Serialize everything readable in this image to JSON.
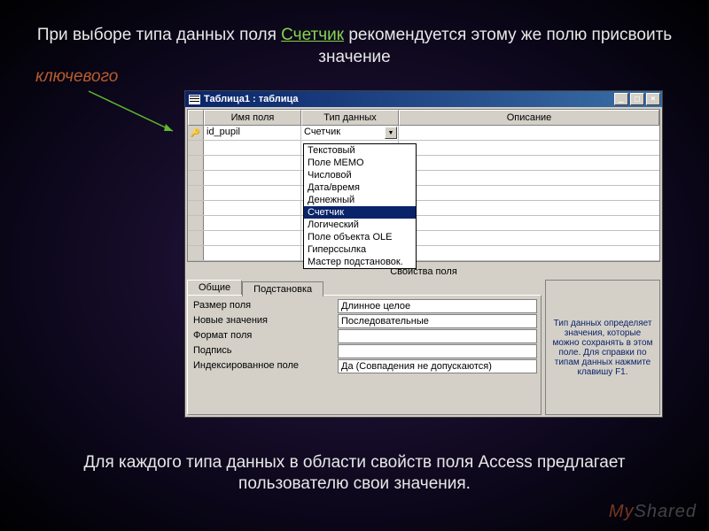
{
  "slide": {
    "top_line1": "При выборе типа данных поля ",
    "top_accent": "Счетчик",
    "top_line2": " рекомендуется этому же полю присвоить значение",
    "key_word": "ключевого",
    "bottom": "Для каждого типа данных в области свойств поля Access предлагает пользователю свои значения."
  },
  "window": {
    "title": "Таблица1 : таблица",
    "columns": {
      "name": "Имя поля",
      "type": "Тип данных",
      "desc": "Описание"
    },
    "row1": {
      "field": "id_pupil",
      "type": "Счетчик"
    },
    "dropdown": [
      "Текстовый",
      "Поле МЕМО",
      "Числовой",
      "Дата/время",
      "Денежный",
      "Счетчик",
      "Логический",
      "Поле объекта OLE",
      "Гиперссылка",
      "Мастер подстановок."
    ],
    "dropdown_selected": "Счетчик",
    "props_title": "Свойства поля",
    "tabs": {
      "general": "Общие",
      "lookup": "Подстановка"
    },
    "props": {
      "size_l": "Размер поля",
      "size_v": "Длинное целое",
      "new_l": "Новые значения",
      "new_v": "Последовательные",
      "fmt_l": "Формат поля",
      "fmt_v": "",
      "cap_l": "Подпись",
      "cap_v": "",
      "idx_l": "Индексированное поле",
      "idx_v": "Да (Совпадения не допускаются)"
    },
    "help": "Тип данных определяет значения, которые можно сохранять в этом поле. Для справки по типам данных нажмите клавишу F1."
  },
  "watermark": {
    "a": "My",
    "b": "Shared"
  }
}
